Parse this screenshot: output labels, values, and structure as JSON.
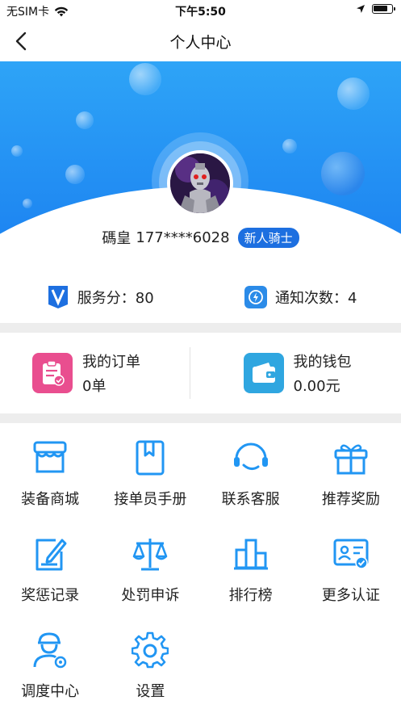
{
  "status_bar": {
    "carrier": "无SIM卡",
    "time": "下午5:50"
  },
  "nav": {
    "title": "个人中心"
  },
  "profile": {
    "name": "碼皇",
    "phone": "177****6028",
    "badge": "新人骑士"
  },
  "stats": {
    "service_score_label": "服务分：80",
    "notify_count_label": "通知次数：4"
  },
  "cards": {
    "orders": {
      "title": "我的订单",
      "value": "0单"
    },
    "wallet": {
      "title": "我的钱包",
      "value": "0.00元"
    }
  },
  "grid": [
    {
      "label": "装备商城",
      "icon": "shop-icon"
    },
    {
      "label": "接单员手册",
      "icon": "handbook-icon"
    },
    {
      "label": "联系客服",
      "icon": "headset-icon"
    },
    {
      "label": "推荐奖励",
      "icon": "gift-icon"
    },
    {
      "label": "奖惩记录",
      "icon": "edit-record-icon"
    },
    {
      "label": "处罚申诉",
      "icon": "scale-icon"
    },
    {
      "label": "排行榜",
      "icon": "ranking-icon"
    },
    {
      "label": "更多认证",
      "icon": "id-card-icon"
    },
    {
      "label": "调度中心",
      "icon": "dispatcher-icon"
    },
    {
      "label": "设置",
      "icon": "gear-icon"
    }
  ],
  "colors": {
    "accent": "#2196f3",
    "hero_top": "#2ea4f7",
    "order_icon_bg": "#e94e8f",
    "wallet_icon_bg": "#2fa6e0",
    "badge_bg": "#1d6fe0"
  }
}
